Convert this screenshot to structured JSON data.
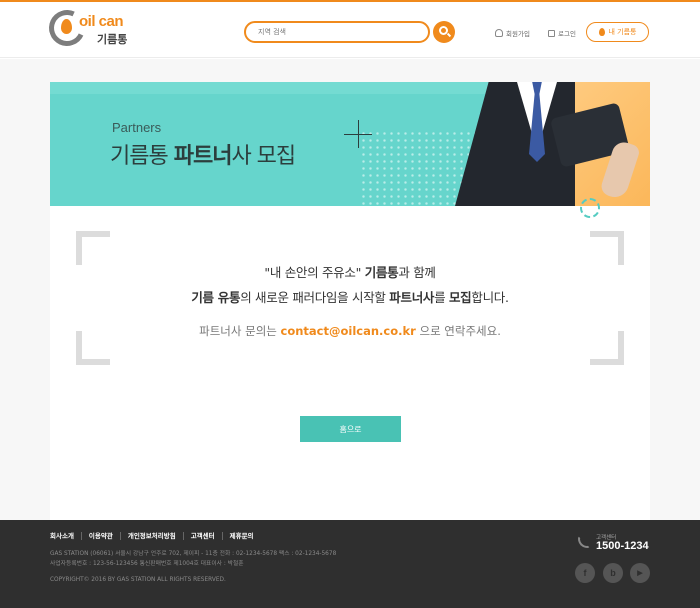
{
  "header": {
    "logo_text": "oil can",
    "logo_korean": "기름통",
    "search_placeholder": "지역 검색",
    "join_label": "회원가입",
    "login_label": "로그인",
    "my_button_label": "내 기름통"
  },
  "banner": {
    "en_title": "Partners",
    "ko_prefix": "기름통 ",
    "ko_bold": "파트너",
    "ko_suffix": "사 모집"
  },
  "message": {
    "l1_a": "\"내 손안의 주유소\" ",
    "l1_b": "기름통",
    "l1_c": "과 함께",
    "l2_a": "기름 유통",
    "l2_b": "의 새로운 패러다임을 시작할 ",
    "l2_c": "파트너사",
    "l2_d": "를 ",
    "l2_e": "모집",
    "l2_f": "합니다.",
    "contact_prefix": "파트너사 문의는 ",
    "contact_email": "contact@oilcan.co.kr",
    "contact_suffix": " 으로 연락주세요."
  },
  "home_button": "홈으로",
  "footer": {
    "nav": [
      "회사소개",
      "이용약관",
      "개인정보처리방침",
      "고객센터",
      "제휴문의"
    ],
    "info1": "GAS STATION (06061) 서울시 강남구 언주로 702, 제이피 - 11층    전화 : 02-1234-5678    팩스 : 02-1234-5678",
    "info2": "사업자등록번호 : 123-56-123456    통신판매번호 제1004호    대표이사 : 박철훈",
    "copyright": "COPYRIGHT© 2016 BY GAS STATION ALL RIGHTS RESERVED.",
    "cs_label": "고객센터",
    "cs_phone": "1500-1234",
    "sns": [
      {
        "icon": "facebook-icon",
        "glyph": "f"
      },
      {
        "icon": "blog-icon",
        "glyph": "b"
      },
      {
        "icon": "youtube-icon",
        "glyph": "▶"
      }
    ]
  },
  "colors": {
    "accent": "#f08a1c",
    "teal": "#66d5cc",
    "home_button": "#49c2b4",
    "footer_bg": "#2f2f2f"
  }
}
